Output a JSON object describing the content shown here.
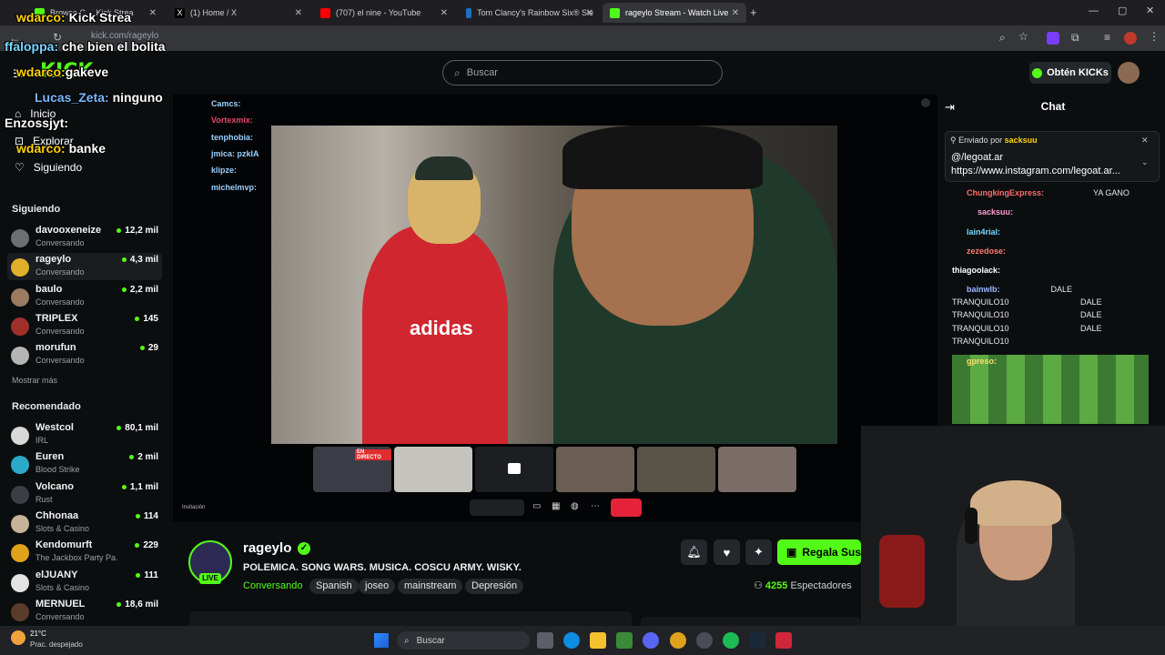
{
  "browser": {
    "tabs": [
      {
        "label": "Browse C…  Kick Strea",
        "color": "#53fc18"
      },
      {
        "label": "(1) Home / X",
        "color": "#ffffff"
      },
      {
        "label": "(707) el nine - YouTube",
        "color": "#ff0000"
      },
      {
        "label": "Tom Clancy's Rainbow Six® Sie",
        "color": "#1b6fc4"
      },
      {
        "label": "rageylo Stream - Watch Live",
        "color": "#53fc18"
      }
    ],
    "url": "kick.com/rageylo"
  },
  "overlay_chat": [
    {
      "user": "wdarco:",
      "text": "Kick Strea"
    },
    {
      "user": "ffaloppa:",
      "text": "che bien el bolita"
    },
    {
      "user": "wdarco:",
      "text": "gakeve"
    },
    {
      "user": "Lucas_Zeta:",
      "text": "ninguno"
    },
    {
      "user": "Enzossjyt:",
      "text": ""
    },
    {
      "user": "wdarco:",
      "text": "banke"
    }
  ],
  "header": {
    "search_placeholder": "Buscar",
    "kicks_label": "Obtén KICKs"
  },
  "sidebar": {
    "nav": [
      {
        "label": "Inicio",
        "icon": "home-icon"
      },
      {
        "label": "Explorar",
        "icon": "compass-icon"
      },
      {
        "label": "Siguiendo",
        "icon": "heart-icon"
      }
    ],
    "following_title": "Siguiendo",
    "following": [
      {
        "name": "davooxeneize",
        "sub": "Conversando",
        "count": "12,2 mil",
        "color": "#6a6f74"
      },
      {
        "name": "rageylo",
        "sub": "Conversando",
        "count": "4,3 mil",
        "color": "#e0b02a"
      },
      {
        "name": "baulo",
        "sub": "Conversando",
        "count": "2,2 mil",
        "color": "#9a7a60"
      },
      {
        "name": "TRIPLEX",
        "sub": "Conversando",
        "count": "145",
        "color": "#a0302a"
      },
      {
        "name": "morufun",
        "sub": "Conversando",
        "count": "29",
        "color": "#b5b5b5"
      }
    ],
    "show_more": "Mostrar más",
    "recommended_title": "Recomendado",
    "recommended": [
      {
        "name": "Westcol",
        "sub": "IRL",
        "count": "80,1 mil",
        "color": "#d8d8d8"
      },
      {
        "name": "Euren",
        "sub": "Blood Strike",
        "count": "2 mil",
        "color": "#2aa9c9"
      },
      {
        "name": "Volcano",
        "sub": "Rust",
        "count": "1,1 mil",
        "color": "#3a3f46"
      },
      {
        "name": "Chhonaa",
        "sub": "Slots & Casino",
        "count": "114",
        "color": "#c7b29a"
      },
      {
        "name": "Kendomurft",
        "sub": "The Jackbox Party Pa...",
        "count": "229",
        "color": "#e0a21a"
      },
      {
        "name": "elJUANY",
        "sub": "Slots & Casino",
        "count": "111",
        "color": "#e3e3e3"
      },
      {
        "name": "MERNUEL",
        "sub": "Conversando",
        "count": "18,6 mil",
        "color": "#5a3c2c"
      }
    ]
  },
  "video_overlay": {
    "chat_lines": [
      "Camcs:",
      "Vortexmix:",
      "tenphobia:",
      "jmica: pzkIA",
      "klipze:",
      "michelmvp:"
    ],
    "invite_label": "Invitación",
    "en_directo": "EN DIRECTO"
  },
  "channel": {
    "name": "rageylo",
    "live": "LIVE",
    "title": "POLEMICA. SONG WARS. MUSICA. COSCU ARMY. WISKY.",
    "category": "Conversando",
    "tags": [
      "Spanish",
      "joseo",
      "mainstream",
      "Depresión"
    ],
    "sub_label": "Regala Susc",
    "viewers": "4255",
    "viewers_label": "Espectadores"
  },
  "chat": {
    "title": "Chat",
    "pinned_by_label": "Enviado por",
    "pinned_by": "sacksuu",
    "pinned_line1": "@/legoat.ar",
    "pinned_line2": "https://www.instagram.com/legoat.ar...",
    "messages": [
      {
        "user": "ChungkingExpress:",
        "text": "YA GANO",
        "color": "#ff6b6b"
      },
      {
        "user": "sacksuu:",
        "text": "",
        "color": "#ff9ad5"
      },
      {
        "user": "lain4rial:",
        "text": "",
        "color": "#7ad7ff"
      },
      {
        "user": "zezedose:",
        "text": "",
        "color": "#ff7a7a"
      },
      {
        "user": "thiagoolack:",
        "text": "",
        "color": "#ffffff"
      },
      {
        "user": "bainwlb:",
        "text": "DALE",
        "color": "#9ab8ff"
      },
      {
        "user": "",
        "text": "TRANQUILO10",
        "color": "#ffffff"
      },
      {
        "user": "",
        "text": "DALE",
        "color": "#ffffff"
      },
      {
        "user": "",
        "text": "TRANQUILO10",
        "color": "#ffffff"
      },
      {
        "user": "",
        "text": "DALE",
        "color": "#ffffff"
      },
      {
        "user": "",
        "text": "TRANQUILO10",
        "color": "#ffffff"
      },
      {
        "user": "",
        "text": "DALE",
        "color": "#ffffff"
      },
      {
        "user": "",
        "text": "TRANQUILO10",
        "color": "#ffffff"
      },
      {
        "user": "gpreso:",
        "text": "",
        "color": "#ffe06b"
      }
    ]
  },
  "taskbar": {
    "weather_temp": "21°C",
    "weather_desc": "Prac. despejado",
    "search_placeholder": "Buscar"
  }
}
